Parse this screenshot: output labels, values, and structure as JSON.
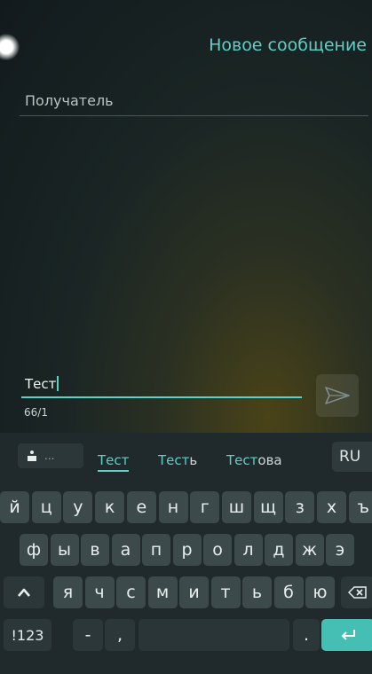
{
  "header": {
    "title": "Новое сообщение"
  },
  "recipient": {
    "placeholder": "Получатель"
  },
  "message": {
    "text": "Тест",
    "counter": "66/1"
  },
  "suggestions": {
    "options_icon": "dot-bar-icon",
    "options_dots": "...",
    "items": [
      {
        "typed": "Тест",
        "completion": ""
      },
      {
        "typed": "Тест",
        "completion": "ь"
      },
      {
        "typed": "Тест",
        "completion": "ова"
      }
    ],
    "language": "RU"
  },
  "keyboard": {
    "row1": [
      "й",
      "ц",
      "у",
      "к",
      "е",
      "н",
      "г",
      "ш",
      "щ",
      "з",
      "х",
      "ъ"
    ],
    "row2": [
      "ф",
      "ы",
      "в",
      "а",
      "п",
      "р",
      "о",
      "л",
      "д",
      "ж",
      "э"
    ],
    "row3": [
      "я",
      "ч",
      "с",
      "м",
      "и",
      "т",
      "ь",
      "б",
      "ю"
    ],
    "shift_icon": "caret-up-icon",
    "backspace_icon": "backspace-icon",
    "numbers_label": "!123",
    "dash_label": "-",
    "comma_label": ",",
    "period_label": ".",
    "enter_icon": "enter-arrow-icon"
  },
  "colors": {
    "accent": "#5fd0c8",
    "enter_key": "#45bfb4",
    "key": "#3c4a4c"
  }
}
